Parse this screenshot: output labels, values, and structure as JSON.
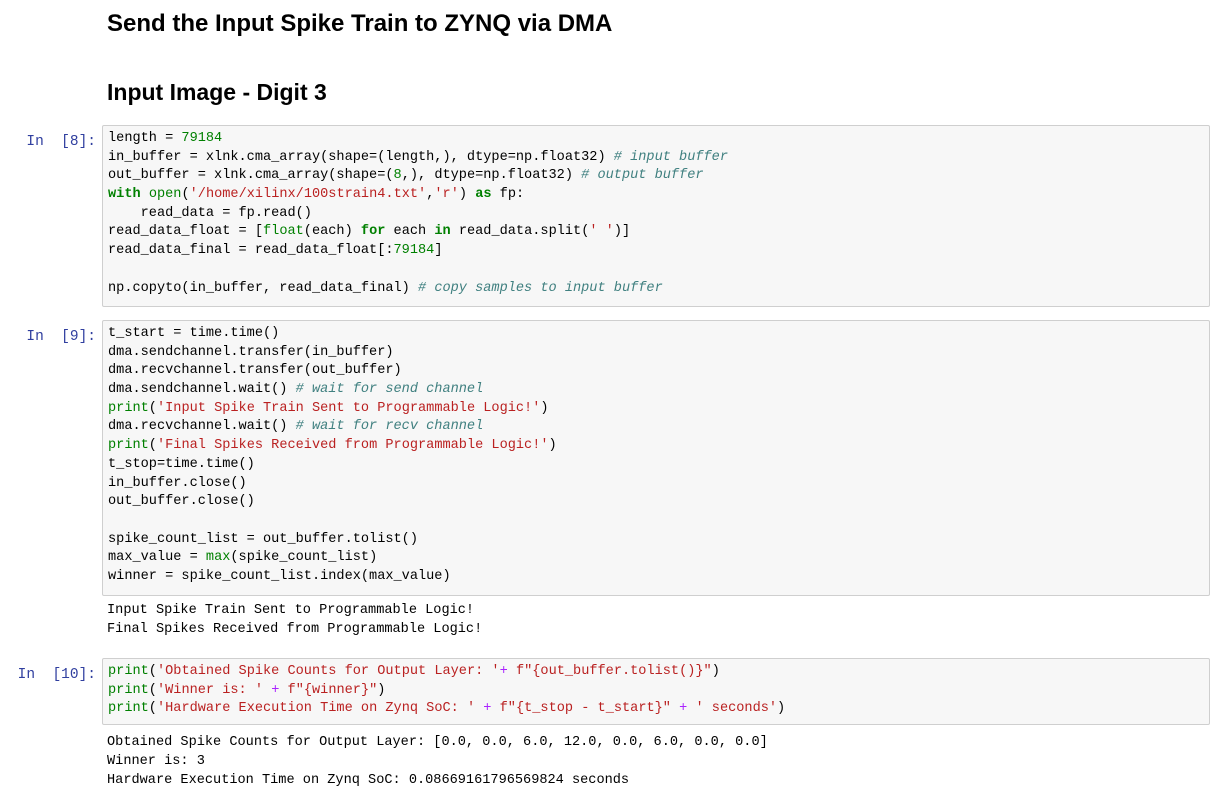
{
  "headings": {
    "h1": "Send the Input Spike Train to ZYNQ via DMA",
    "h2": "Input Image - Digit 3"
  },
  "cells": [
    {
      "prompt": "In  [8]:",
      "lines": [
        [
          [
            "",
            "length = "
          ],
          [
            "num",
            "79184"
          ]
        ],
        [
          [
            "",
            "in_buffer = xlnk.cma_array(shape=(length,), dtype=np.float32) "
          ],
          [
            "cm",
            "# input buffer"
          ]
        ],
        [
          [
            "",
            "out_buffer = xlnk.cma_array(shape=("
          ],
          [
            "num",
            "8"
          ],
          [
            "",
            ",), dtype=np.float32) "
          ],
          [
            "cm",
            "# output buffer"
          ]
        ],
        [
          [
            "kw",
            "with"
          ],
          [
            "",
            " "
          ],
          [
            "bi",
            "open"
          ],
          [
            "",
            "("
          ],
          [
            "str",
            "'/home/xilinx/100strain4.txt'"
          ],
          [
            "",
            ","
          ],
          [
            "str",
            "'r'"
          ],
          [
            "",
            ") "
          ],
          [
            "kw",
            "as"
          ],
          [
            "",
            " fp:"
          ]
        ],
        [
          [
            "",
            "    read_data = fp.read()"
          ]
        ],
        [
          [
            "",
            "read_data_float = ["
          ],
          [
            "bi",
            "float"
          ],
          [
            "",
            "(each) "
          ],
          [
            "kw",
            "for"
          ],
          [
            "",
            " each "
          ],
          [
            "kw",
            "in"
          ],
          [
            "",
            " read_data.split("
          ],
          [
            "str",
            "' '"
          ],
          [
            "",
            ")]"
          ]
        ],
        [
          [
            "",
            "read_data_final = read_data_float[:"
          ],
          [
            "num",
            "79184"
          ],
          [
            "",
            "]"
          ]
        ],
        [
          [
            "",
            ""
          ]
        ],
        [
          [
            "",
            "np.copyto(in_buffer, read_data_final) "
          ],
          [
            "cm",
            "# copy samples to input buffer"
          ]
        ]
      ],
      "output": []
    },
    {
      "prompt": "In  [9]:",
      "lines": [
        [
          [
            "",
            "t_start = time.time()"
          ]
        ],
        [
          [
            "",
            "dma.sendchannel.transfer(in_buffer)"
          ]
        ],
        [
          [
            "",
            "dma.recvchannel.transfer(out_buffer)"
          ]
        ],
        [
          [
            "",
            "dma.sendchannel.wait() "
          ],
          [
            "cm",
            "# wait for send channel"
          ]
        ],
        [
          [
            "bi",
            "print"
          ],
          [
            "",
            "("
          ],
          [
            "str",
            "'Input Spike Train Sent to Programmable Logic!'"
          ],
          [
            "",
            ")"
          ]
        ],
        [
          [
            "",
            "dma.recvchannel.wait() "
          ],
          [
            "cm",
            "# wait for recv channel"
          ]
        ],
        [
          [
            "bi",
            "print"
          ],
          [
            "",
            "("
          ],
          [
            "str",
            "'Final Spikes Received from Programmable Logic!'"
          ],
          [
            "",
            ")"
          ]
        ],
        [
          [
            "",
            "t_stop=time.time()"
          ]
        ],
        [
          [
            "",
            "in_buffer.close()"
          ]
        ],
        [
          [
            "",
            "out_buffer.close()"
          ]
        ],
        [
          [
            "",
            ""
          ]
        ],
        [
          [
            "",
            "spike_count_list = out_buffer.tolist()"
          ]
        ],
        [
          [
            "",
            "max_value = "
          ],
          [
            "bi",
            "max"
          ],
          [
            "",
            "(spike_count_list)"
          ]
        ],
        [
          [
            "",
            "winner = spike_count_list.index(max_value)"
          ]
        ]
      ],
      "output": [
        "Input Spike Train Sent to Programmable Logic!",
        "Final Spikes Received from Programmable Logic!"
      ]
    },
    {
      "prompt": "In  [10]:",
      "lines": [
        [
          [
            "bi",
            "print"
          ],
          [
            "",
            "("
          ],
          [
            "str",
            "'Obtained Spike Counts for Output Layer: '"
          ],
          [
            "op",
            "+"
          ],
          [
            "",
            " "
          ],
          [
            "str",
            "f\"{out_buffer.tolist()}\""
          ],
          [
            "",
            ")"
          ]
        ],
        [
          [
            "bi",
            "print"
          ],
          [
            "",
            "("
          ],
          [
            "str",
            "'Winner is: '"
          ],
          [
            "",
            " "
          ],
          [
            "op",
            "+"
          ],
          [
            "",
            " "
          ],
          [
            "str",
            "f\"{winner}\""
          ],
          [
            "",
            ")"
          ]
        ],
        [
          [
            "bi",
            "print"
          ],
          [
            "",
            "("
          ],
          [
            "str",
            "'Hardware Execution Time on Zynq SoC: '"
          ],
          [
            "",
            " "
          ],
          [
            "op",
            "+"
          ],
          [
            "",
            " "
          ],
          [
            "str",
            "f\"{t_stop - t_start}\""
          ],
          [
            "",
            " "
          ],
          [
            "op",
            "+"
          ],
          [
            "",
            " "
          ],
          [
            "str",
            "' seconds'"
          ],
          [
            "",
            ")"
          ]
        ]
      ],
      "output": [
        "Obtained Spike Counts for Output Layer: [0.0, 0.0, 6.0, 12.0, 0.0, 6.0, 0.0, 0.0]",
        "Winner is: 3",
        "Hardware Execution Time on Zynq SoC: 0.08669161796569824 seconds"
      ]
    }
  ]
}
